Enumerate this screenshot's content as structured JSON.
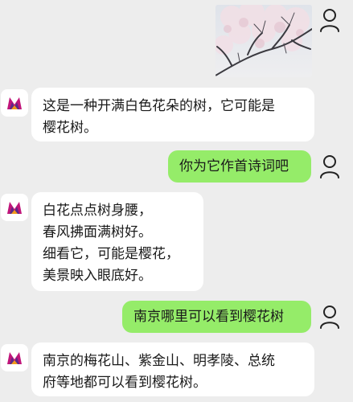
{
  "chat": {
    "messages": [
      {
        "role": "user",
        "type": "image",
        "icon": "cherry-blossom-tree-photo"
      },
      {
        "role": "assistant",
        "text": "这是一种开满白色花朵的树，它可能是\n樱花树。"
      },
      {
        "role": "user",
        "text": "你为它作首诗词吧"
      },
      {
        "role": "assistant",
        "text": "白花点点树身腰，\n春风拂面满树好。\n细看它，可能是樱花，\n美景映入眼底好。"
      },
      {
        "role": "user",
        "text": "南京哪里可以看到樱花树"
      },
      {
        "role": "assistant",
        "text": "南京的梅花山、紫金山、明孝陵、总统\n府等地都可以看到樱花树。"
      }
    ]
  },
  "colors": {
    "background": "#ededed",
    "user_bubble": "#95ec69",
    "assistant_bubble": "#ffffff",
    "avatar_magenta": "#c0157a",
    "avatar_purple": "#5b2a86",
    "avatar_orange": "#f39a1c"
  },
  "icons": {
    "user_avatar": "user-icon",
    "assistant_avatar": "assistant-logo-icon"
  }
}
